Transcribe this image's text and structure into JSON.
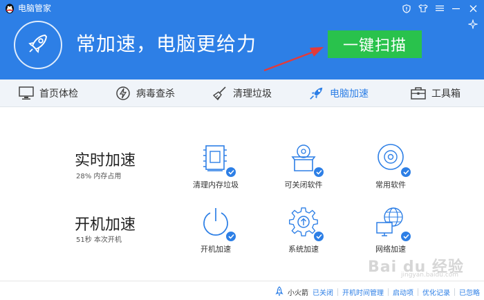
{
  "app": {
    "title": "电脑管家",
    "slogan": "常加速，电脑更给力",
    "scan_button": "一键扫描"
  },
  "tabs": [
    {
      "label": "首页体检",
      "icon": "monitor-icon"
    },
    {
      "label": "病毒查杀",
      "icon": "lightning-shield-icon"
    },
    {
      "label": "清理垃圾",
      "icon": "broom-icon"
    },
    {
      "label": "电脑加速",
      "icon": "rocket-icon",
      "active": true
    },
    {
      "label": "工具箱",
      "icon": "toolbox-icon"
    }
  ],
  "realtime": {
    "title": "实时加速",
    "subtitle": "28% 内存占用",
    "features": [
      {
        "label": "清理内存垃圾",
        "icon": "memory-chip-icon"
      },
      {
        "label": "可关闭软件",
        "icon": "software-box-icon"
      },
      {
        "label": "常用软件",
        "icon": "disc-icon"
      }
    ]
  },
  "boot": {
    "title": "开机加速",
    "subtitle": "51秒 本次开机",
    "features": [
      {
        "label": "开机加速",
        "icon": "power-icon"
      },
      {
        "label": "系统加速",
        "icon": "gear-icon"
      },
      {
        "label": "网络加速",
        "icon": "globe-monitor-icon"
      }
    ]
  },
  "footer": {
    "rocket_label": "小火箭",
    "rocket_status": "已关闭",
    "links": [
      "开机时间管理",
      "启动项",
      "优化记录",
      "已忽略"
    ]
  },
  "watermark": {
    "text": "Bai du 经验",
    "sub": "jingyan.baidu.com"
  },
  "colors": {
    "brand_blue": "#2d7fe6",
    "scan_green": "#29c24c",
    "arrow_red": "#e23b3b"
  }
}
